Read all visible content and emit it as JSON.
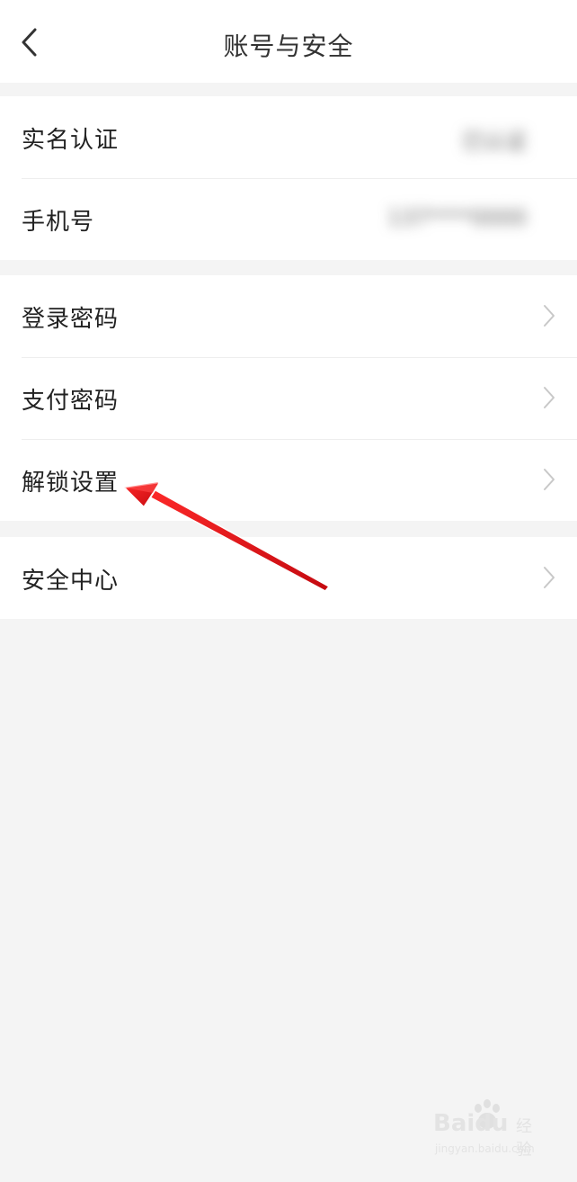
{
  "header": {
    "title": "账号与安全",
    "back_icon": "chevron-left-icon"
  },
  "groups": [
    {
      "rows": [
        {
          "label": "实名认证",
          "value": "已认证",
          "value_blurred": true
        },
        {
          "label": "手机号",
          "value": "137****0000",
          "value_blurred": true
        }
      ]
    },
    {
      "rows": [
        {
          "label": "登录密码",
          "icon": "chevron-right-icon"
        },
        {
          "label": "支付密码",
          "icon": "chevron-right-icon"
        },
        {
          "label": "解锁设置",
          "icon": "chevron-right-icon"
        }
      ]
    },
    {
      "rows": [
        {
          "label": "安全中心",
          "icon": "chevron-right-icon"
        }
      ]
    }
  ],
  "watermark": {
    "brand": "Baidu",
    "sub": "经验",
    "domain": "jingyan.baidu.com"
  },
  "colors": {
    "background": "#f4f4f4",
    "card": "#ffffff",
    "text": "#222222",
    "chevron": "#c8c8c8",
    "arrow": "#e8141a"
  }
}
